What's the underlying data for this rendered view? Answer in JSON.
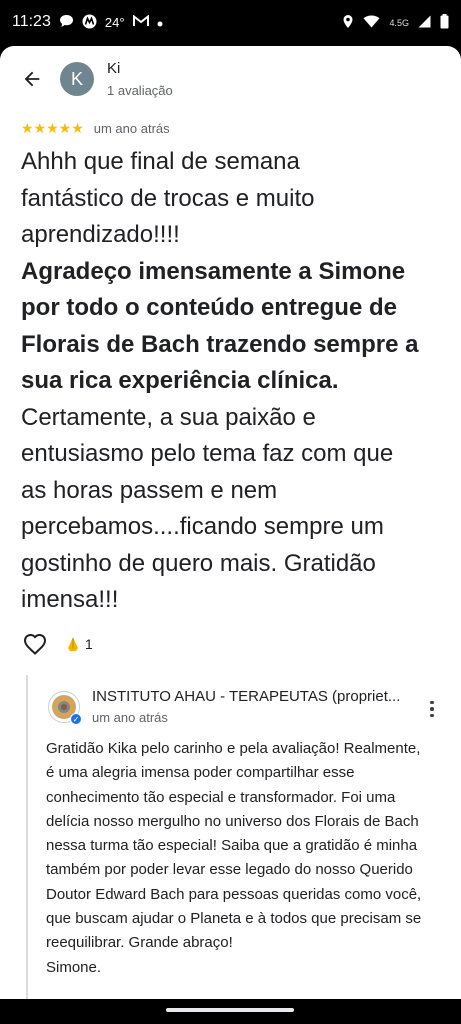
{
  "status_bar": {
    "time": "11:23",
    "temperature": "24°",
    "network": "4.5G"
  },
  "reviewer": {
    "avatar_letter": "K",
    "name": "Ki",
    "review_count": "1 avaliação"
  },
  "review": {
    "stars": "★★★★★",
    "rating": 5,
    "date": "um ano atrás",
    "lines": [
      "Ahhh que final de semana",
      "fantástico de trocas e muito",
      "aprendizado!!!!"
    ],
    "bold_lines": [
      "Agradeço imensamente a Simone",
      "por todo o conteúdo entregue de",
      "Florais de Bach trazendo sempre a",
      "sua rica experiência clínica."
    ],
    "rest_lines": [
      "Certamente, a sua paixão e",
      "entusiasmo pelo tema faz com que",
      "as horas passem e nem",
      "percebamos....ficando sempre um",
      "gostinho de quero mais. Gratidão",
      "imensa!!!"
    ],
    "reaction_count": "1"
  },
  "owner_reply": {
    "name": "INSTITUTO AHAU - TERAPEUTAS (propriet...",
    "date": "um ano atrás",
    "lines": [
      "Gratidão Kika pelo carinho e pela avaliação! Realmente,",
      "é uma alegria imensa poder compartilhar esse",
      "conhecimento tão especial e transformador. Foi uma",
      "delícia nosso mergulho no universo dos Florais de Bach",
      "nessa turma tão especial! Saiba que a gratidão é minha",
      "também por poder levar esse legado do nosso Querido",
      "Doutor Edward Bach para pessoas queridas como você,",
      "que buscam ajudar o Planeta e à todos que precisam se",
      "reequilibrar. Grande abraço!",
      "Simone."
    ]
  },
  "colors": {
    "star": "#fbbc04",
    "avatar_bg": "#6f8590",
    "verified": "#1a73e8"
  },
  "icons": [
    "back-arrow-icon",
    "heart-outline-icon",
    "folded-hands-icon",
    "more-vert-icon",
    "verified-badge-icon"
  ]
}
